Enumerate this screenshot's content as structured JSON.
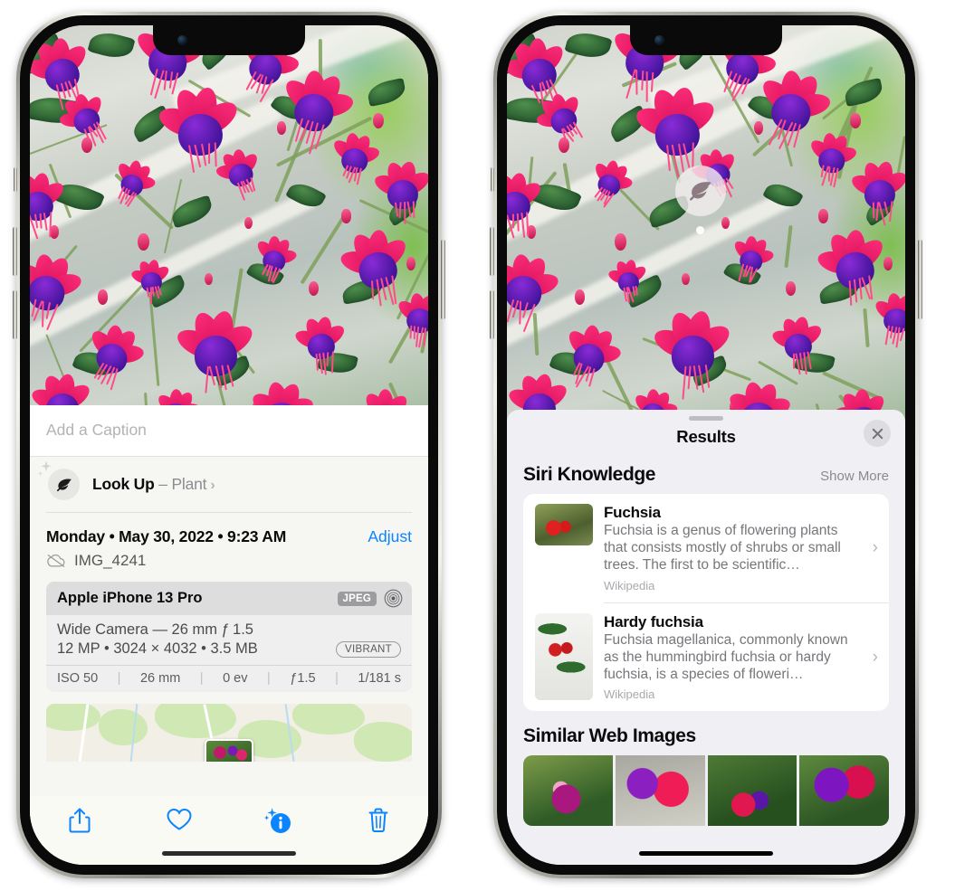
{
  "left_phone": {
    "name": "iphone-photos-info",
    "caption_field": {
      "placeholder": "Add a Caption",
      "value": ""
    },
    "lookup_row": {
      "icon": "leaf-icon",
      "label": "Look Up",
      "dash": " – ",
      "subject": "Plant",
      "chevron": "›"
    },
    "date_row": {
      "date": "Monday • May 30, 2022 • 9:23 AM",
      "adjust_label": "Adjust"
    },
    "file_row": {
      "icon": "icloud-slash-icon",
      "filename": "IMG_4241"
    },
    "exif": {
      "device": "Apple iPhone 13 Pro",
      "format_tag": "JPEG",
      "lens_icon": "lens-icon",
      "lens_line": "Wide Camera — 26 mm ƒ 1.5",
      "size_line": "12 MP • 3024 × 4032 • 3.5 MB",
      "style_pill": "VIBRANT",
      "settings": [
        "ISO 50",
        "26 mm",
        "0 ev",
        "ƒ1.5",
        "1/181 s"
      ],
      "separator": "|"
    },
    "map": {
      "name": "location-map",
      "pin": "photo-thumbnail-pin"
    },
    "toolbar": [
      {
        "name": "share-button",
        "icon": "share-icon"
      },
      {
        "name": "favorite-button",
        "icon": "heart-icon"
      },
      {
        "name": "info-button",
        "icon": "info-sparkle-icon"
      },
      {
        "name": "delete-button",
        "icon": "trash-icon"
      }
    ],
    "accent_color": "#0a84ff"
  },
  "right_phone": {
    "name": "iphone-visual-lookup-results",
    "photo_badge": {
      "icon": "leaf-icon",
      "name": "visual-lookup-leaf-badge"
    },
    "sheet": {
      "grabber": "sheet-grabber",
      "title": "Results",
      "close_icon": "close-icon"
    },
    "siri_knowledge": {
      "section_title": "Siri Knowledge",
      "show_more": "Show More",
      "items": [
        {
          "title": "Fuchsia",
          "description": "Fuchsia is a genus of flowering plants that consists mostly of shrubs or small trees. The first to be scientific…",
          "source": "Wikipedia",
          "chevron": "›"
        },
        {
          "title": "Hardy fuchsia",
          "description": "Fuchsia magellanica, commonly known as the hummingbird fuchsia or hardy fuchsia, is a species of floweri…",
          "source": "Wikipedia",
          "chevron": "›"
        }
      ]
    },
    "similar_web_images": {
      "section_title": "Similar Web Images",
      "thumbnails": [
        {
          "name": "web-image-1"
        },
        {
          "name": "web-image-2"
        },
        {
          "name": "web-image-3"
        },
        {
          "name": "web-image-4"
        }
      ]
    },
    "sheet_bg": "#efeff4",
    "card_bg": "#ffffff"
  }
}
